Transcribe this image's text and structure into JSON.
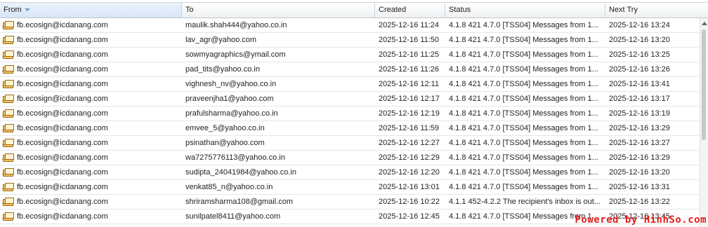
{
  "columns": {
    "from": "From",
    "to": "To",
    "created": "Created",
    "status": "Status",
    "next_try": "Next Try"
  },
  "rows": [
    {
      "from": "fb.ecosign@icdanang.com",
      "to": "maulik.shah444@yahoo.co.in",
      "created": "2025-12-16 11:24",
      "status": "4.1.8 421 4.7.0 [TSS04] Messages from 1...",
      "next_try": "2025-12-16 13:24"
    },
    {
      "from": "fb.ecosign@icdanang.com",
      "to": "lav_agr@yahoo.com",
      "created": "2025-12-16 11:50",
      "status": "4.1.8 421 4.7.0 [TSS04] Messages from 1...",
      "next_try": "2025-12-16 13:20"
    },
    {
      "from": "fb.ecosign@icdanang.com",
      "to": "sowmyagraphics@ymail.com",
      "created": "2025-12-16 11:25",
      "status": "4.1.8 421 4.7.0 [TSS04] Messages from 1...",
      "next_try": "2025-12-16 13:25"
    },
    {
      "from": "fb.ecosign@icdanang.com",
      "to": "pad_tits@yahoo.co.in",
      "created": "2025-12-16 11:26",
      "status": "4.1.8 421 4.7.0 [TSS04] Messages from 1...",
      "next_try": "2025-12-16 13:26"
    },
    {
      "from": "fb.ecosign@icdanang.com",
      "to": "vighnesh_nv@yahoo.co.in",
      "created": "2025-12-16 12:11",
      "status": "4.1.8 421 4.7.0 [TSS04] Messages from 1...",
      "next_try": "2025-12-16 13:41"
    },
    {
      "from": "fb.ecosign@icdanang.com",
      "to": "praveenjha1@yahoo.com",
      "created": "2025-12-16 12:17",
      "status": "4.1.8 421 4.7.0 [TSS04] Messages from 1...",
      "next_try": "2025-12-16 13:17"
    },
    {
      "from": "fb.ecosign@icdanang.com",
      "to": "prafulsharma@yahoo.co.in",
      "created": "2025-12-16 12:19",
      "status": "4.1.8 421 4.7.0 [TSS04] Messages from 1...",
      "next_try": "2025-12-16 13:19"
    },
    {
      "from": "fb.ecosign@icdanang.com",
      "to": "emvee_5@yahoo.co.in",
      "created": "2025-12-16 11:59",
      "status": "4.1.8 421 4.7.0 [TSS04] Messages from 1...",
      "next_try": "2025-12-16 13:29"
    },
    {
      "from": "fb.ecosign@icdanang.com",
      "to": "psinathan@yahoo.com",
      "created": "2025-12-16 12:27",
      "status": "4.1.8 421 4.7.0 [TSS04] Messages from 1...",
      "next_try": "2025-12-16 13:27"
    },
    {
      "from": "fb.ecosign@icdanang.com",
      "to": "wa7275776113@yahoo.co.in",
      "created": "2025-12-16 12:29",
      "status": "4.1.8 421 4.7.0 [TSS04] Messages from 1...",
      "next_try": "2025-12-16 13:29"
    },
    {
      "from": "fb.ecosign@icdanang.com",
      "to": "sudipta_24041984@yahoo.co.in",
      "created": "2025-12-16 12:20",
      "status": "4.1.8 421 4.7.0 [TSS04] Messages from 1...",
      "next_try": "2025-12-16 13:20"
    },
    {
      "from": "fb.ecosign@icdanang.com",
      "to": "venkat85_n@yahoo.co.in",
      "created": "2025-12-16 13:01",
      "status": "4.1.8 421 4.7.0 [TSS04] Messages from 1...",
      "next_try": "2025-12-16 13:31"
    },
    {
      "from": "fb.ecosign@icdanang.com",
      "to": "shriramsharma108@gmail.com",
      "created": "2025-12-16 10:22",
      "status": "4.1.1 452-4.2.2 The recipient's inbox is out...",
      "next_try": "2025-12-16 13:22"
    },
    {
      "from": "fb.ecosign@icdanang.com",
      "to": "sunilpatel8411@yahoo.com",
      "created": "2025-12-16 12:45",
      "status": "4.1.8 421 4.7.0 [TSS04] Messages from 1...",
      "next_try": "2025-12-16 13:45"
    }
  ],
  "icons": {
    "row_icon": "mail-envelope-icon",
    "sort_indicator": "sort-descending-icon",
    "scroll_up": "scroll-up-arrow-icon"
  },
  "watermark": "Powered by HinhSo.com"
}
